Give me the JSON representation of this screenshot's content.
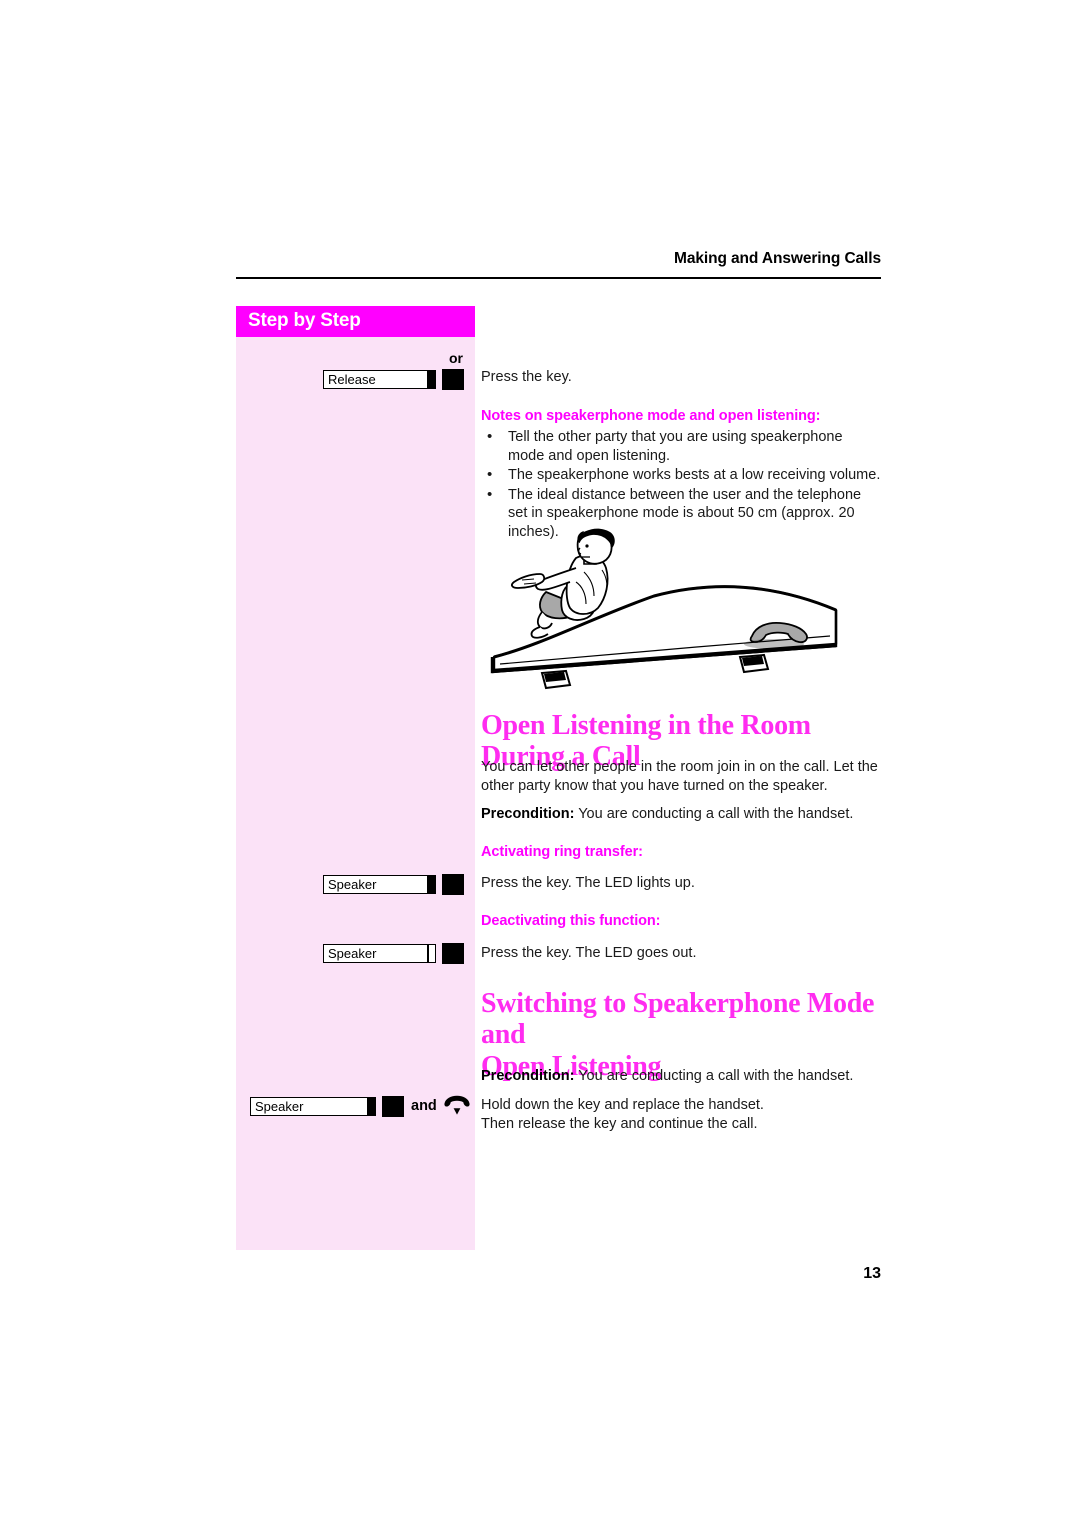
{
  "header": {
    "running_title": "Making and Answering Calls"
  },
  "sidebar": {
    "title": "Step by Step",
    "or_label": "or",
    "keys": [
      {
        "id": "release-key",
        "label": "Release",
        "led": "on",
        "has_square": true,
        "and_label": null,
        "handset_icon": null
      },
      {
        "id": "speaker-key-activate",
        "label": "Speaker",
        "led": "on",
        "has_square": true,
        "and_label": null,
        "handset_icon": null
      },
      {
        "id": "speaker-key-deactivate",
        "label": "Speaker",
        "led": "off",
        "has_square": true,
        "and_label": null,
        "handset_icon": null
      },
      {
        "id": "speaker-key-handset",
        "label": "Speaker",
        "led": "on",
        "has_square": true,
        "and_label": "and",
        "handset_icon": "hang-up-handset-icon"
      }
    ]
  },
  "main": {
    "press_the_key": "Press the key.",
    "notes_heading": "Notes on speakerphone mode and open listening:",
    "notes_bullets": [
      "Tell the other party that you are using speakerphone mode and open listening.",
      "The speakerphone works bests at a low receiving volume.",
      "The ideal distance between the user and the telephone set in speakerphone mode is about 50 cm (approx. 20 inches)."
    ],
    "illustration_caption": "man-sitting-on-telephone-illustration",
    "section1": {
      "heading": "Open Listening in the Room During a Call",
      "intro": "You can let other people in the room join in on the call. Let the other party know that you have turned on the speaker.",
      "precondition_label": "Precondition:",
      "precondition_text": " You are conducting a call with the handset.",
      "activating_heading": "Activating ring transfer:",
      "activating_text": "Press the key. The LED lights up.",
      "deactivating_heading": "Deactivating this function:",
      "deactivating_text": "Press the key. The LED goes out."
    },
    "section2": {
      "heading_line1": "Switching to Speakerphone Mode and",
      "heading_line2": "Open Listening",
      "precondition_label": "Precondition:",
      "precondition_text": " You are conducting a call with the handset.",
      "instruction_line1": "Hold down the key and replace the handset.",
      "instruction_line2": "Then release the key and continue the call."
    }
  },
  "footer": {
    "page_number": "13"
  },
  "colors": {
    "magenta": "#ff00ff",
    "heading_pink": "#ff2cf0",
    "panel_pink": "#fbe2f7",
    "text": "#1a1a1a"
  }
}
